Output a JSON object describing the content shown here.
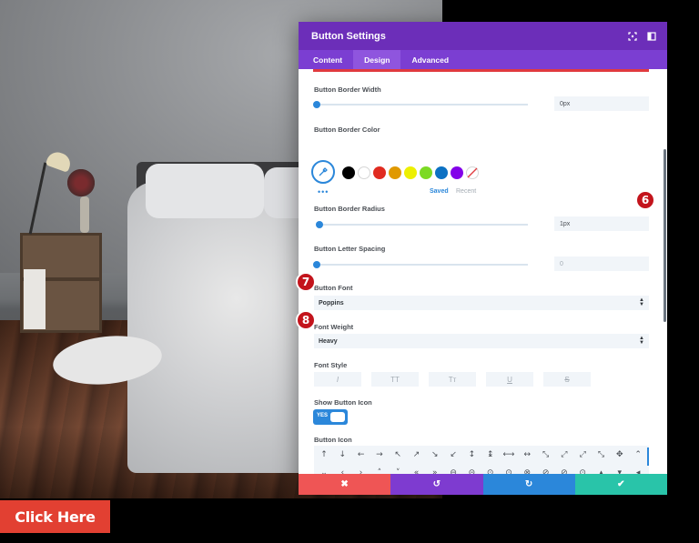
{
  "page": {
    "cta_label": "Click Here"
  },
  "modal": {
    "title": "Button Settings",
    "tabs": [
      {
        "label": "Content",
        "active": false
      },
      {
        "label": "Design",
        "active": true
      },
      {
        "label": "Advanced",
        "active": false
      }
    ],
    "header_icons": [
      "expand-icon",
      "sidebar-toggle-icon"
    ]
  },
  "settings": {
    "border_width": {
      "label": "Button Border Width",
      "value": "0px"
    },
    "border_color": {
      "label": "Button Border Color",
      "swatches": [
        "#000000",
        "#ffffff",
        "#e02b20",
        "#e09900",
        "#edf000",
        "#7cda24",
        "#0c71c3",
        "#8300e9"
      ],
      "saved_label": "Saved",
      "recent_label": "Recent"
    },
    "border_radius": {
      "label": "Button Border Radius",
      "value": "1px"
    },
    "letter_spacing": {
      "label": "Button Letter Spacing",
      "value": "0"
    },
    "font": {
      "label": "Button Font",
      "value": "Poppins"
    },
    "font_weight": {
      "label": "Font Weight",
      "value": "Heavy"
    },
    "font_style": {
      "label": "Font Style",
      "buttons": [
        "I",
        "TT",
        "Tт",
        "U",
        "S"
      ]
    },
    "show_icon": {
      "label": "Show Button Icon",
      "toggle_text": "YES",
      "on": true
    },
    "button_icon": {
      "label": "Button Icon",
      "rows": [
        [
          "↑",
          "↓",
          "←",
          "→",
          "↖",
          "↗",
          "↘",
          "↙",
          "↕",
          "↨",
          "⟷",
          "↔",
          "⤡",
          "⤢",
          "⤢",
          "⤡",
          "✥",
          "⌃"
        ],
        [
          "⌄",
          "‹",
          "›",
          "˄",
          "˅",
          "«",
          "»",
          "⊖",
          "⊝",
          "⊙",
          "⊙",
          "⊗",
          "⊘",
          "⊘",
          "⊙",
          "▴",
          "▾",
          "◂"
        ],
        [
          "▸",
          "⊙",
          "⊙",
          "⊙",
          "⊙",
          "↰",
          "–",
          "+",
          "×",
          "✓",
          "⊖",
          "⊕",
          "⊗",
          "⊘",
          "⌕",
          "⌕",
          "⌕",
          "□"
        ]
      ]
    }
  },
  "markers": [
    "6",
    "7",
    "8"
  ],
  "footer": {
    "buttons": [
      {
        "name": "cancel",
        "glyph": "✖",
        "color": "#ef5555"
      },
      {
        "name": "undo",
        "glyph": "↺",
        "color": "#7e3bd0"
      },
      {
        "name": "redo",
        "glyph": "↻",
        "color": "#2b87da"
      },
      {
        "name": "save",
        "glyph": "✔",
        "color": "#29c4a9"
      }
    ]
  },
  "colors": {
    "header": "#6c2eb9",
    "tabs": "#7b3ed2",
    "accent": "#2b87da",
    "marker": "#c3141c",
    "cta": "#e24032"
  }
}
